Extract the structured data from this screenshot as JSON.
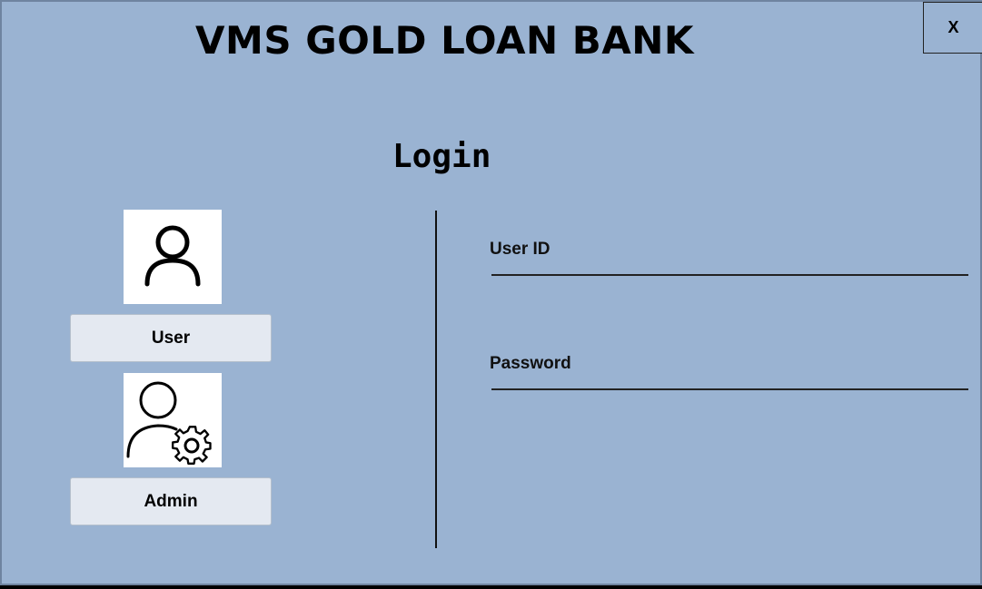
{
  "window": {
    "title": "VMS GOLD LOAN BANK",
    "close_label": "X"
  },
  "login": {
    "heading": "Login"
  },
  "roles": {
    "user_label": "User",
    "admin_label": "Admin",
    "user_icon": "user-icon",
    "admin_icon": "user-settings-icon"
  },
  "form": {
    "user_id_label": "User ID",
    "user_id_value": "",
    "password_label": "Password",
    "password_value": ""
  },
  "colors": {
    "background": "#9ab3d2",
    "button": "#e4e9f1",
    "text": "#000000"
  }
}
